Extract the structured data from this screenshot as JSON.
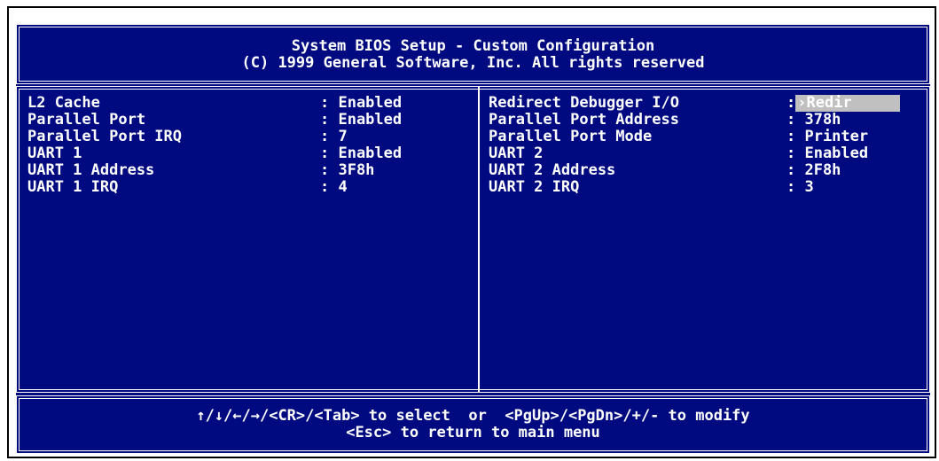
{
  "header": {
    "title": "System BIOS Setup - Custom Configuration",
    "copyright": "(C) 1999 General Software, Inc. All rights reserved"
  },
  "left_panel": [
    {
      "label": "L2 Cache",
      "value": ": Enabled"
    },
    {
      "label": "Parallel Port",
      "value": ": Enabled"
    },
    {
      "label": "Parallel Port IRQ",
      "value": ": 7"
    },
    {
      "label": "UART 1",
      "value": ": Enabled"
    },
    {
      "label": "UART 1 Address",
      "value": ": 3F8h"
    },
    {
      "label": "UART 1 IRQ",
      "value": ": 4"
    }
  ],
  "right_panel": [
    {
      "label": "Redirect Debugger I/O",
      "value": "Redir",
      "selected": true
    },
    {
      "label": "Parallel Port Address",
      "value": ": 378h"
    },
    {
      "label": "Parallel Port Mode",
      "value": ": Printer"
    },
    {
      "label": "UART 2",
      "value": ": Enabled"
    },
    {
      "label": "UART 2 Address",
      "value": ": 2F8h"
    },
    {
      "label": "UART 2 IRQ",
      "value": ": 3"
    }
  ],
  "selected_prefix": ":",
  "cursor_glyph": "›",
  "footer": {
    "line1": "↑/↓/←/→/<CR>/<Tab> to select  or  <PgUp>/<PgDn>/+/- to modify",
    "line2": "<Esc> to return to main menu"
  },
  "colors": {
    "background": "#000a80",
    "text": "#ffffff",
    "highlight": "#c0c0c0"
  }
}
